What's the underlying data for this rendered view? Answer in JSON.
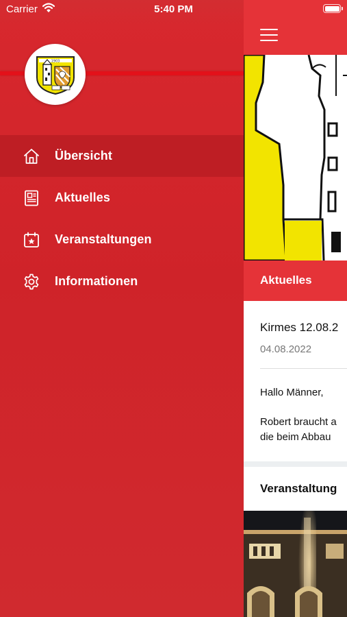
{
  "status_bar": {
    "carrier": "Carrier",
    "time": "5:40 PM"
  },
  "drawer": {
    "logo": {
      "icon": "club-crest-logo"
    },
    "active_index": 0,
    "items": [
      {
        "label": "Übersicht",
        "icon": "home-icon"
      },
      {
        "label": "Aktuelles",
        "icon": "newspaper-icon"
      },
      {
        "label": "Veranstaltungen",
        "icon": "calendar-star-icon"
      },
      {
        "label": "Informationen",
        "icon": "gear-icon"
      }
    ]
  },
  "main": {
    "menu_icon": "hamburger-icon",
    "section_title": "Aktuelles",
    "news_card": {
      "title": "Kirmes 12.08.2",
      "date": "04.08.2022",
      "greeting": "Hallo Männer,",
      "body_line1": "Robert braucht a",
      "body_line2": "die beim Abbau"
    },
    "events_title": "Veranstaltung"
  },
  "colors": {
    "drawer_red": "#d02a2f",
    "header_red": "#e53338",
    "accent_line": "#e3111a",
    "crest_yellow": "#f2e400"
  }
}
